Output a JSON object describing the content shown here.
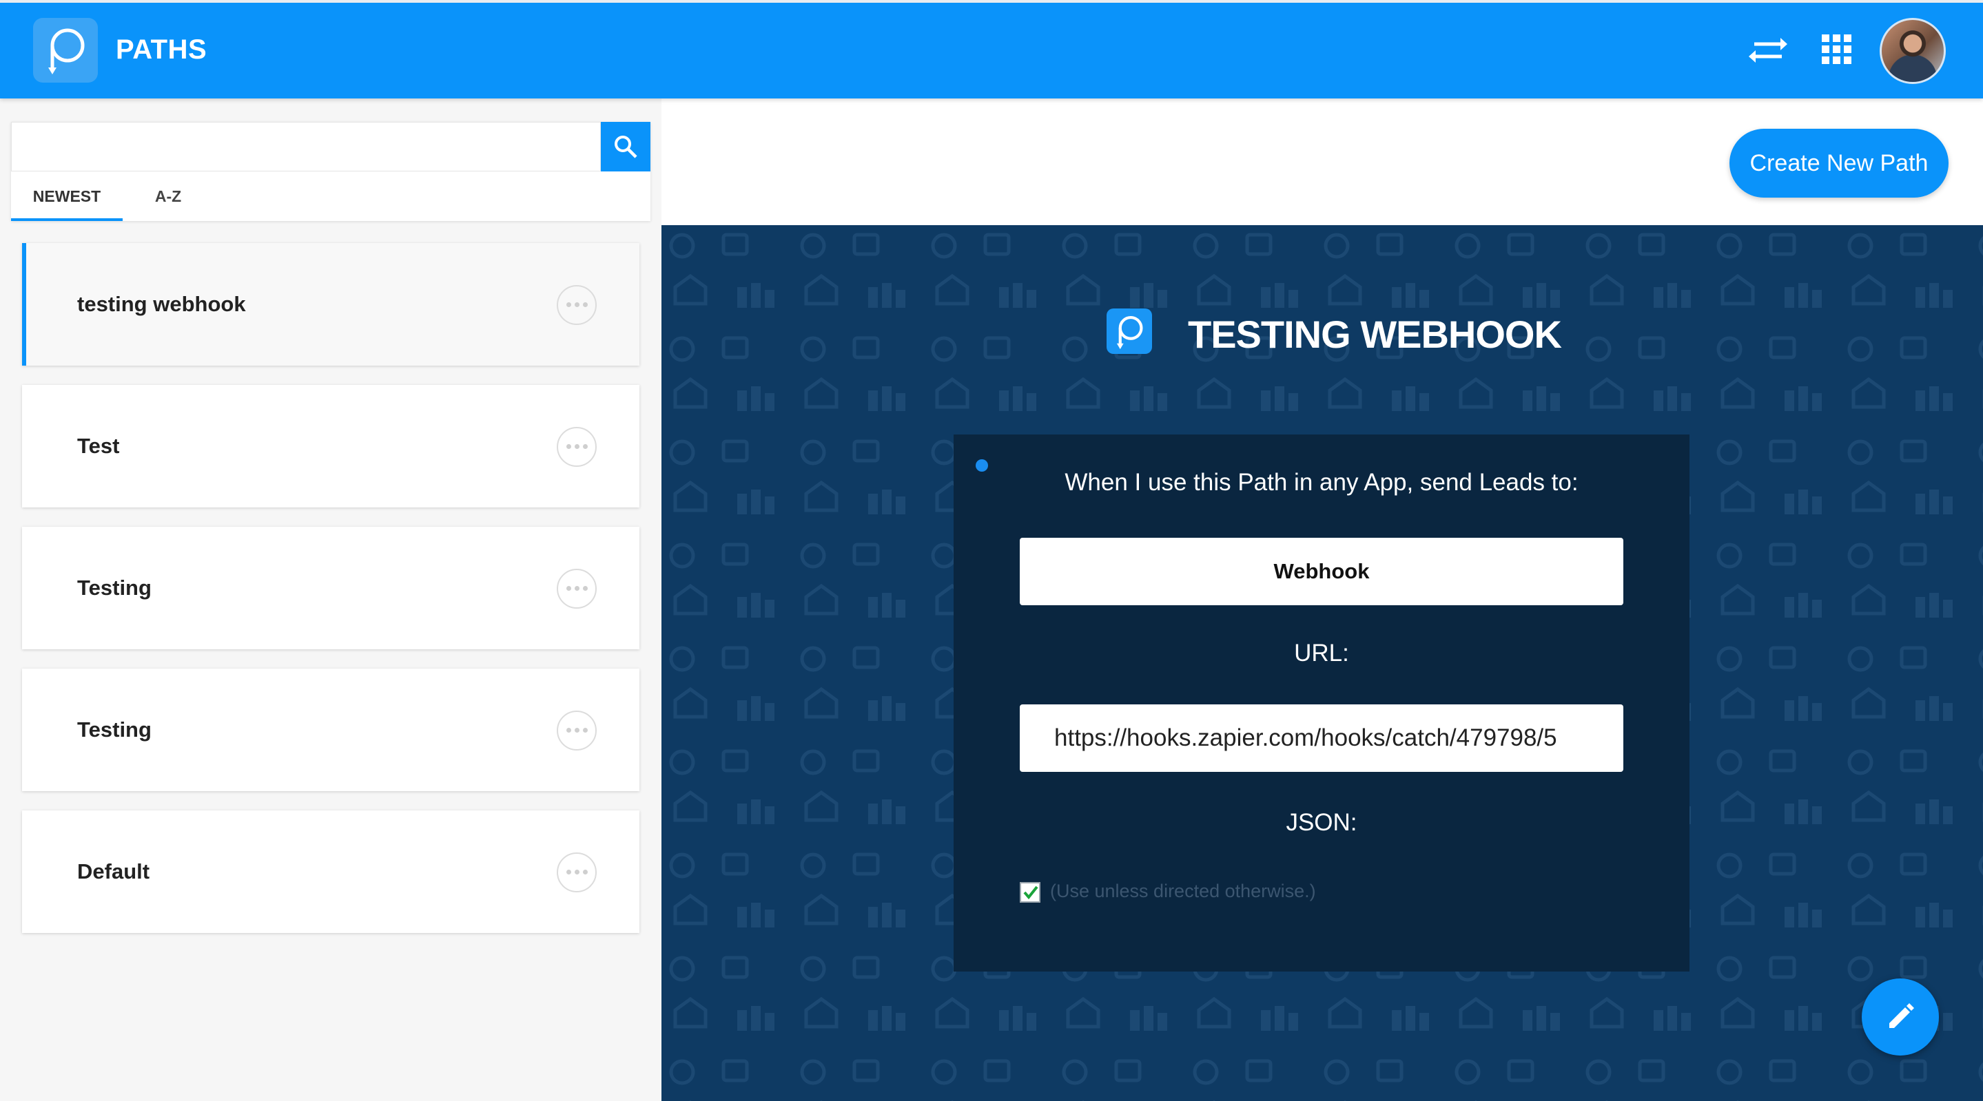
{
  "header": {
    "app_title": "PATHS",
    "icons": [
      "paths-logo-icon",
      "swap-arrows-icon",
      "apps-grid-icon"
    ],
    "avatar": "user-avatar"
  },
  "sidebar": {
    "search": {
      "value": "",
      "placeholder": ""
    },
    "tabs": [
      {
        "label": "NEWEST",
        "active": true
      },
      {
        "label": "A-Z",
        "active": false
      }
    ],
    "paths": [
      {
        "name": "testing webhook",
        "active": true
      },
      {
        "name": "Test",
        "active": false
      },
      {
        "name": "Testing",
        "active": false
      },
      {
        "name": "Testing",
        "active": false
      },
      {
        "name": "Default",
        "active": false
      }
    ]
  },
  "toolbar": {
    "create_label": "Create New Path"
  },
  "detail": {
    "title": "TESTING WEBHOOK",
    "heading": "When I use this Path in any App, send Leads to:",
    "destination": "Webhook",
    "url_label": "URL:",
    "url_value": "https://hooks.zapier.com/hooks/catch/479798/5",
    "json_label": "JSON:",
    "json_checked": true,
    "json_hint": "(Use unless directed otherwise.)"
  },
  "colors": {
    "primary": "#0a93fa",
    "panel_bg": "#0e3a63",
    "card_bg": "#0a2640"
  }
}
